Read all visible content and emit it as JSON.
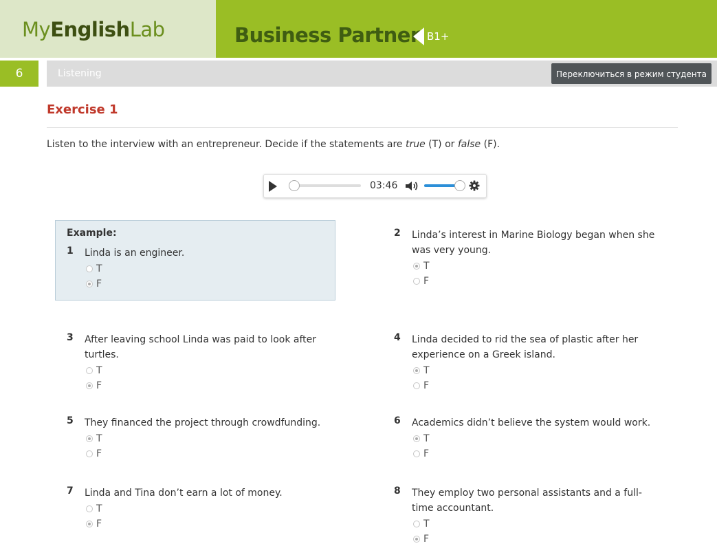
{
  "header": {
    "logo_my": "My",
    "logo_english": "English",
    "logo_lab": "Lab",
    "product": "Business Partner",
    "level": "B1+"
  },
  "unit": {
    "number": "6",
    "title": "Listening",
    "switch_label": "Переключиться в режим студента"
  },
  "exercise": {
    "title": "Exercise 1",
    "instruction_start": "Listen to the interview with an entrepreneur. Decide if the statements are ",
    "true_word": "true",
    "true_abbr": " (T) or ",
    "false_word": "false",
    "false_abbr": " (F)."
  },
  "player": {
    "time": "03:46",
    "position": 0,
    "volume": 1
  },
  "example_label": "Example:",
  "questions": [
    {
      "num": "1",
      "lines": [
        "Linda is an engineer."
      ],
      "selected": "F"
    },
    {
      "num": "2",
      "lines": [
        "Linda’s interest in Marine Biology began when she",
        "was very young."
      ],
      "selected": "T"
    },
    {
      "num": "3",
      "lines": [
        "After leaving school Linda was paid to look after",
        "turtles."
      ],
      "selected": "F"
    },
    {
      "num": "4",
      "lines": [
        "Linda decided to rid the sea of plastic after her",
        "experience on a Greek island."
      ],
      "selected": "T"
    },
    {
      "num": "5",
      "lines": [
        "They financed the project through crowdfunding."
      ],
      "selected": "T"
    },
    {
      "num": "6",
      "lines": [
        "Academics didn’t believe the system would work."
      ],
      "selected": "T"
    },
    {
      "num": "7",
      "lines": [
        "Linda and Tina don’t earn a lot of money."
      ],
      "selected": "F"
    },
    {
      "num": "8",
      "lines": [
        "They employ two personal assistants and a full-",
        "time accountant."
      ],
      "selected": "F"
    }
  ],
  "options": {
    "t": "T",
    "f": "F"
  },
  "colors": {
    "brand_green": "#9abe25",
    "exercise_red": "#c0392b",
    "volume_blue": "#2c8fd8"
  }
}
